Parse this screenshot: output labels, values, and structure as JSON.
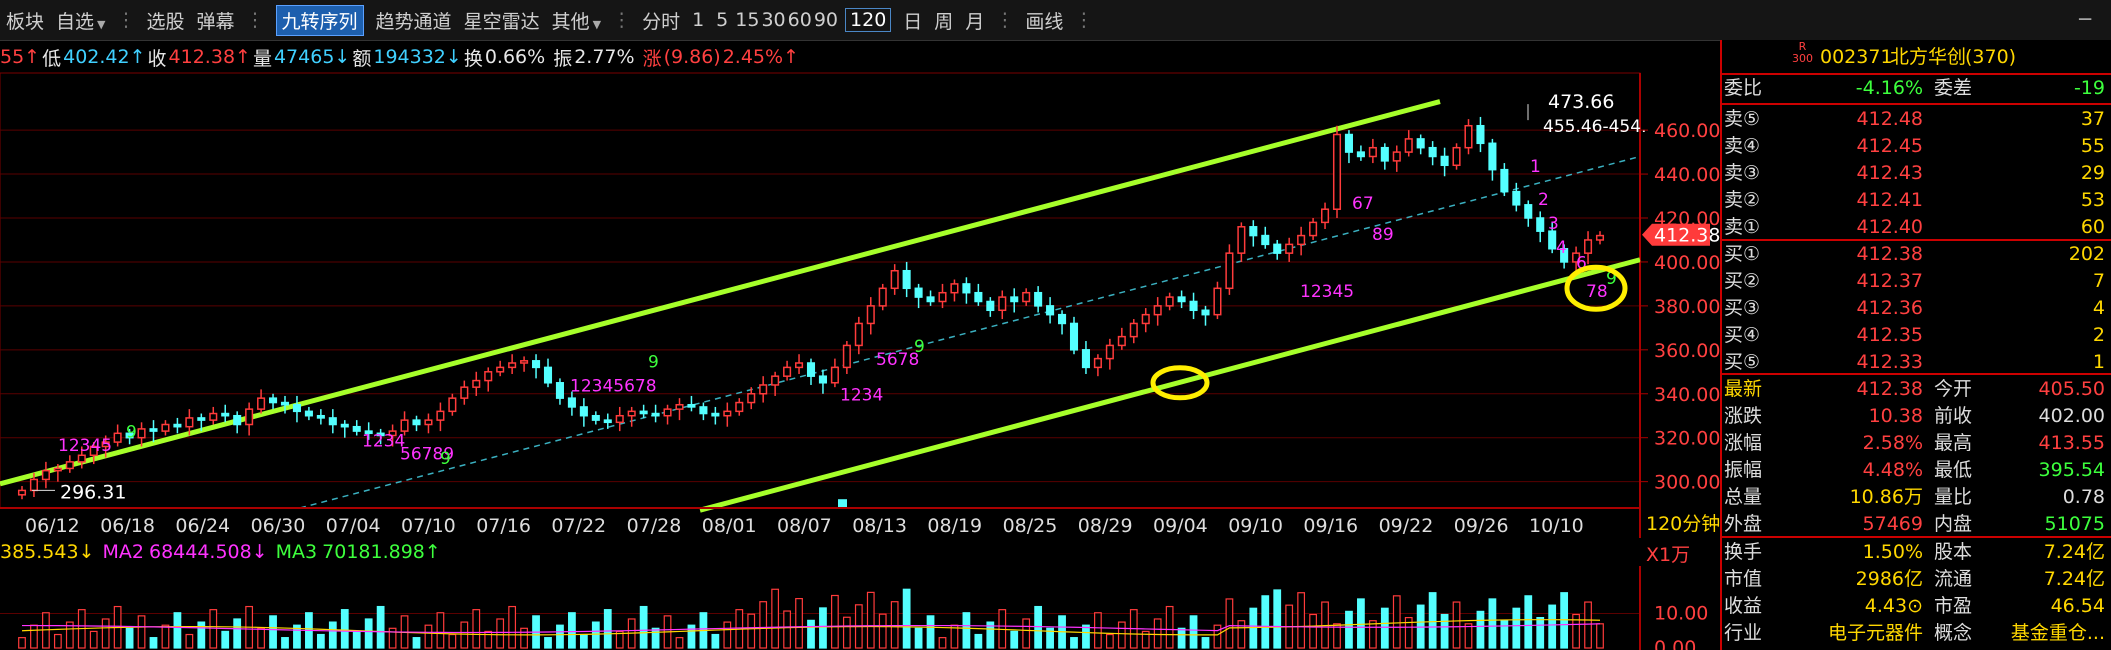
{
  "toolbar": {
    "items": [
      "板块",
      "自选",
      "选股",
      "弹幕",
      "九转序列",
      "趋势通道",
      "星空雷达",
      "其他",
      "分时",
      "1",
      "5",
      "15",
      "30",
      "60",
      "90",
      "120",
      "日",
      "周",
      "月",
      "画线"
    ]
  },
  "info_bar": {
    "high": "55↑",
    "low_label": "低",
    "low": "402.42↑",
    "close_label": "收",
    "close": "412.38↑",
    "vol_label": "量",
    "vol": "47465↓",
    "amt_label": "额",
    "amt": "194332↓",
    "turn_label": "换",
    "turn": "0.66%",
    "amp_label": "振",
    "amp": "2.77%",
    "chg_label": "涨",
    "chg": "(9.86)",
    "chg_pct": "2.45%↑"
  },
  "chart_data": {
    "type": "candlestick",
    "period": "120分钟",
    "x_tick_labels": [
      "06/12",
      "06/18",
      "06/24",
      "06/30",
      "07/04",
      "07/10",
      "07/16",
      "07/22",
      "07/28",
      "08/01",
      "08/07",
      "08/13",
      "08/19",
      "08/25",
      "08/29",
      "09/04",
      "09/10",
      "09/16",
      "09/22",
      "09/26",
      "10/10"
    ],
    "y_tick_labels": [
      "460.00",
      "440.00",
      "420.00",
      "400.00",
      "380.00",
      "360.00",
      "340.00",
      "320.00",
      "300.00"
    ],
    "ylim": [
      288,
      486
    ],
    "closes": [
      296,
      301,
      305,
      306,
      309,
      312,
      316,
      318,
      322,
      320,
      324,
      323,
      326,
      325,
      329,
      328,
      331,
      330,
      326,
      333,
      338,
      336,
      335,
      332,
      330,
      329,
      326,
      325,
      323,
      322,
      321,
      323,
      328,
      326,
      328,
      332,
      338,
      343,
      346,
      350,
      352,
      354,
      355,
      352,
      345,
      338,
      334,
      330,
      328,
      327,
      330,
      332,
      331,
      330,
      333,
      335,
      334,
      331,
      330,
      332,
      336,
      340,
      344,
      348,
      352,
      354,
      348,
      345,
      352,
      362,
      372,
      380,
      388,
      396,
      388,
      384,
      382,
      386,
      390,
      386,
      382,
      378,
      384,
      382,
      386,
      380,
      376,
      372,
      360,
      352,
      356,
      362,
      366,
      372,
      376,
      380,
      384,
      382,
      378,
      376,
      388,
      404,
      416,
      412,
      408,
      404,
      408,
      412,
      418,
      424,
      458,
      450,
      448,
      452,
      446,
      450,
      456,
      452,
      448,
      444,
      452,
      462,
      454,
      442,
      432,
      426,
      420,
      414,
      406,
      400,
      404,
      410,
      412
    ],
    "volume_ylim": [
      0,
      22
    ],
    "volume_tick_labels": [
      "10.00",
      "0.00"
    ],
    "high_marker": "473.66",
    "range_marker": "455.46-454.",
    "low_marker": "296.31",
    "last_price": "412.38",
    "td_sequences": [
      {
        "digits": "1234567",
        "color": "magenta",
        "tail": "8",
        "tail2": "9"
      },
      {
        "digits": "123456789"
      },
      {
        "digits": "12345678",
        "tail": "9"
      },
      {
        "digits": "1234"
      },
      {
        "digits": "56789"
      },
      {
        "digits": "12345",
        "tail": "6789"
      },
      {
        "digits": "1234",
        "tail": "56789"
      }
    ]
  },
  "ma_bar": {
    "ma1": "385.543↓",
    "ma2_label": "MA2",
    "ma2": "68444.508↓",
    "ma3_label": "MA3",
    "ma3": "70181.898↑"
  },
  "volume_unit": "X1万",
  "quote": {
    "code_badge_top": "R",
    "code_badge_bottom": "300",
    "code": "002371",
    "name": "北方华创",
    "count": "(370)",
    "weibi_label": "委比",
    "weibi": "-4.16%",
    "weicha_label": "委差",
    "weicha": "-19",
    "asks": [
      {
        "label": "卖⑤",
        "price": "412.48",
        "vol": "37"
      },
      {
        "label": "卖④",
        "price": "412.45",
        "vol": "55"
      },
      {
        "label": "卖③",
        "price": "412.43",
        "vol": "29"
      },
      {
        "label": "卖②",
        "price": "412.41",
        "vol": "53"
      },
      {
        "label": "卖①",
        "price": "412.40",
        "vol": "60"
      }
    ],
    "bids": [
      {
        "label": "买①",
        "price": "412.38",
        "vol": "202"
      },
      {
        "label": "买②",
        "price": "412.37",
        "vol": "7"
      },
      {
        "label": "买③",
        "price": "412.36",
        "vol": "4"
      },
      {
        "label": "买④",
        "price": "412.35",
        "vol": "2"
      },
      {
        "label": "买⑤",
        "price": "412.33",
        "vol": "1"
      }
    ],
    "stats": [
      {
        "l1": "最新",
        "v1": "412.38",
        "l2": "今开",
        "v2": "405.50"
      },
      {
        "l1": "涨跌",
        "v1": "10.38",
        "l2": "前收",
        "v2": "402.00"
      },
      {
        "l1": "涨幅",
        "v1": "2.58%",
        "l2": "最高",
        "v2": "413.55"
      },
      {
        "l1": "振幅",
        "v1": "4.48%",
        "l2": "最低",
        "v2": "395.54"
      },
      {
        "l1": "总量",
        "v1": "10.86万",
        "l2": "量比",
        "v2": "0.78"
      },
      {
        "l1": "外盘",
        "v1": "57469",
        "l2": "内盘",
        "v2": "51075"
      }
    ],
    "stats2": [
      {
        "l1": "换手",
        "v1": "1.50%",
        "l2": "股本",
        "v2": "7.24亿"
      },
      {
        "l1": "市值",
        "v1": "2986亿",
        "l2": "流通",
        "v2": "7.24亿"
      },
      {
        "l1": "收益",
        "v1": "4.43⊙",
        "l2": "市盈",
        "v2": "46.54"
      },
      {
        "l1": "行业",
        "v1": "电子元器件",
        "l2": "概念",
        "v2": "基金重仓..."
      }
    ]
  },
  "colors": {
    "up": "#ff3b3b",
    "down": "#54ffff",
    "channel": "#a6ff2a",
    "panel_border": "#cc0000",
    "td": "#ff33ff",
    "td_green": "#3dff3d"
  }
}
